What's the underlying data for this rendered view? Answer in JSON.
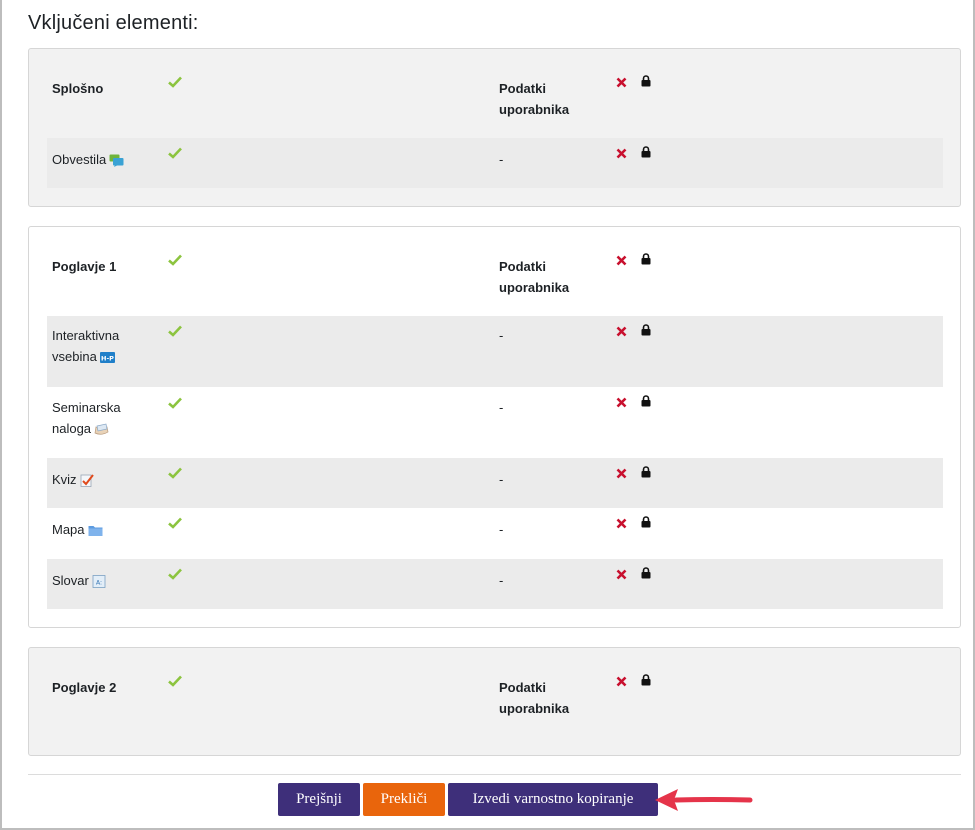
{
  "page": {
    "title": "Vključeni elementi:"
  },
  "sections": [
    {
      "header": {
        "name": "Splošno",
        "user_data": "Podatki uporabnika"
      },
      "items": [
        {
          "name": "Obvestila",
          "icon": "forum-icon",
          "user_data": "-"
        }
      ]
    },
    {
      "header": {
        "name": "Poglavje 1",
        "user_data": "Podatki uporabnika"
      },
      "items": [
        {
          "name": "Interaktivna vsebina",
          "icon": "h5p-icon",
          "user_data": "-"
        },
        {
          "name": "Seminarska naloga",
          "icon": "assignment-icon",
          "user_data": "-"
        },
        {
          "name": "Kviz",
          "icon": "quiz-icon",
          "user_data": "-"
        },
        {
          "name": "Mapa",
          "icon": "folder-icon",
          "user_data": "-"
        },
        {
          "name": "Slovar",
          "icon": "glossary-icon",
          "user_data": "-"
        }
      ]
    },
    {
      "header": {
        "name": "Poglavje 2",
        "user_data": "Podatki uporabnika"
      },
      "items": []
    }
  ],
  "buttons": {
    "previous": "Prejšnji",
    "cancel": "Prekliči",
    "perform_backup": "Izvedi varnostno kopiranje"
  },
  "colors": {
    "primary": "#3e2f7a",
    "cancel": "#e9650c",
    "check": "#8cc43f",
    "cross": "#c8102e",
    "annotation_arrow": "#e5344a"
  }
}
